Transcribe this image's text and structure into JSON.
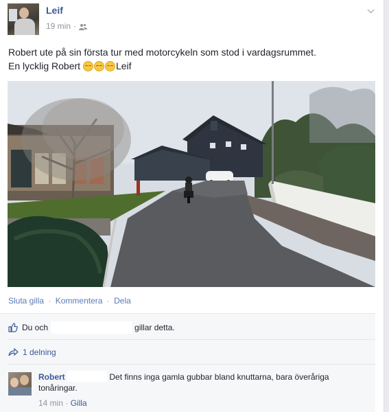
{
  "post": {
    "author": "Leif",
    "time": "19 min",
    "text_line1": "Robert ute på sin första tur med motorcykeln som stod i vardagsrummet.",
    "text_line2_prefix": "En lycklig Robert ",
    "text_line2_suffix": "Leif",
    "emoji_count": 3
  },
  "actions": {
    "like": "Sluta gilla",
    "comment": "Kommentera",
    "share": "Dela",
    "separator": "·"
  },
  "likes": {
    "prefix": "Du och",
    "suffix": "gillar detta."
  },
  "shares": {
    "label": "1 delning"
  },
  "comment": {
    "author": "Robert",
    "text": "Det finns inga gamla gubbar bland knuttarna, bara överåriga tonåringar.",
    "time": "14 min",
    "like": "Gilla"
  },
  "colors": {
    "link": "#3b5998",
    "meta": "#90949c",
    "panel": "#f6f7f9"
  }
}
